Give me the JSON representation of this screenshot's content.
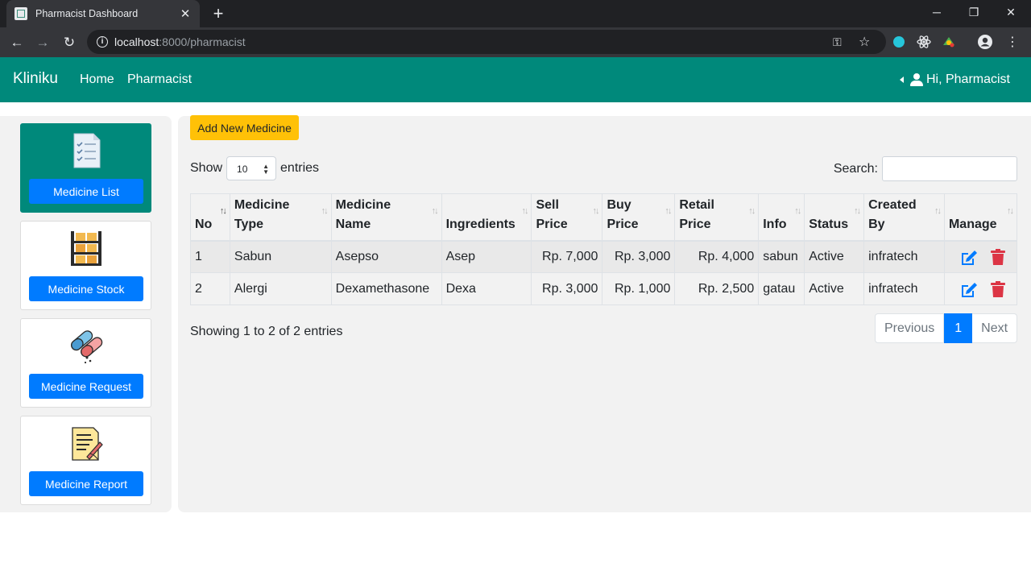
{
  "browser": {
    "tab_title": "Pharmacist Dashboard",
    "url_host": "localhost",
    "url_rest": ":8000/pharmacist"
  },
  "navbar": {
    "brand": "Kliniku",
    "links": [
      "Home",
      "Pharmacist"
    ],
    "user_greeting": "Hi, Pharmacist",
    "color": "#00897b"
  },
  "sidebar": {
    "items": [
      {
        "label": "Medicine List",
        "icon": "checklist-icon",
        "active": true
      },
      {
        "label": "Medicine Stock",
        "icon": "shelf-boxes-icon",
        "active": false
      },
      {
        "label": "Medicine Request",
        "icon": "pills-capsules-icon",
        "active": false
      },
      {
        "label": "Medicine Report",
        "icon": "report-document-icon",
        "active": false
      }
    ]
  },
  "main": {
    "add_button": "Add New Medicine",
    "show_label": "Show",
    "entries_value": "10",
    "entries_label": "entries",
    "search_label": "Search:",
    "search_value": "",
    "columns": [
      [
        "No"
      ],
      [
        "Medicine",
        "Type"
      ],
      [
        "Medicine",
        "Name"
      ],
      [
        "Ingredients"
      ],
      [
        "Sell",
        "Price"
      ],
      [
        "Buy",
        "Price"
      ],
      [
        "Retail",
        "Price"
      ],
      [
        "Info"
      ],
      [
        "Status"
      ],
      [
        "Created",
        "By"
      ],
      [
        "Manage"
      ]
    ],
    "rows": [
      {
        "no": "1",
        "type": "Sabun",
        "name": "Asepso",
        "ingredients": "Asep",
        "sell": "Rp. 7,000",
        "buy": "Rp. 3,000",
        "retail": "Rp. 4,000",
        "info": "sabun",
        "status": "Active",
        "created_by": "infratech"
      },
      {
        "no": "2",
        "type": "Alergi",
        "name": "Dexamethasone",
        "ingredients": "Dexa",
        "sell": "Rp. 3,000",
        "buy": "Rp. 1,000",
        "retail": "Rp. 2,500",
        "info": "gatau",
        "status": "Active",
        "created_by": "infratech"
      }
    ],
    "info_text": "Showing 1 to 2 of 2 entries",
    "pagination": {
      "previous": "Previous",
      "current": "1",
      "next": "Next"
    },
    "colors": {
      "primary": "#007bff",
      "warning": "#ffc107",
      "danger": "#dc3545"
    }
  }
}
